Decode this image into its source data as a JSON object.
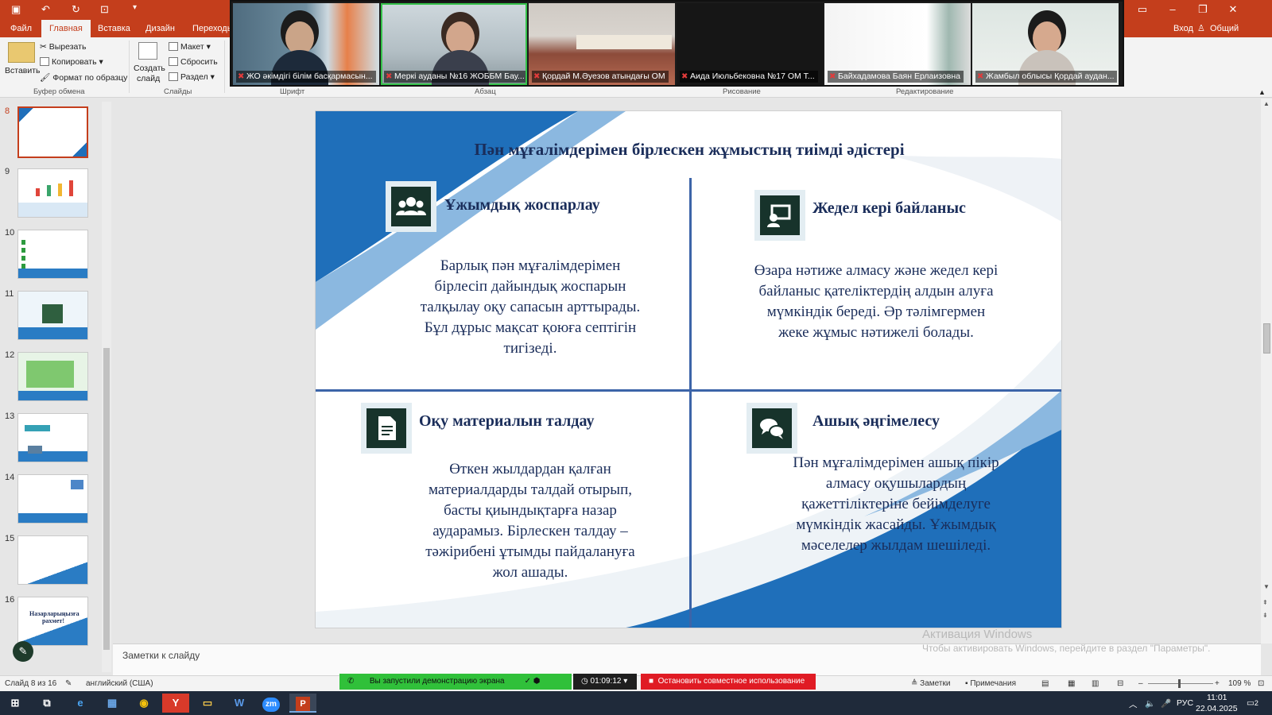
{
  "window": {
    "login_label": "Вход",
    "share_label": "Общий доступ"
  },
  "tabs": [
    {
      "label": "Файл"
    },
    {
      "label": "Главная"
    },
    {
      "label": "Вставка"
    },
    {
      "label": "Дизайн"
    },
    {
      "label": "Переходы"
    }
  ],
  "ribbon": {
    "paste": "Вставить",
    "cut": "Вырезать",
    "copy": "Копировать",
    "format_painter": "Формат по образцу",
    "new_slide": "Создать",
    "new_slide_2": "слайд",
    "layout": "Макет",
    "reset": "Сбросить",
    "section": "Раздел",
    "groups": {
      "clipboard": "Буфер обмена",
      "slides": "Слайды",
      "font": "Шрифт",
      "paragraph": "Абзац",
      "drawing": "Рисование",
      "editing": "Редактирование"
    }
  },
  "video": [
    {
      "name": "ЖО әкімдігі білім басқармасын..."
    },
    {
      "name": "Меркі ауданы  №16 ЖОББМ  Бау..."
    },
    {
      "name": "Қордай М.Әуезов атындағы ОМ"
    },
    {
      "name": "Аида Июльбековна №17 ОМ Т..."
    },
    {
      "name": "Байхадамова Баян Ерлаизовна"
    },
    {
      "name": "Жамбыл облысы Қордай аудан..."
    }
  ],
  "thumbnails": [
    {
      "num": "8"
    },
    {
      "num": "9"
    },
    {
      "num": "10"
    },
    {
      "num": "11"
    },
    {
      "num": "12"
    },
    {
      "num": "13"
    },
    {
      "num": "14"
    },
    {
      "num": "15"
    },
    {
      "num": "16",
      "text": "Назарларыңызға рахмет!"
    }
  ],
  "slide": {
    "title": "Пән мұғалімдерімен бірлескен жұмыстың тиімді әдістері",
    "q1": {
      "title": "Ұжымдық жоспарлау",
      "lines": [
        "Барлық пән мұғалімдерімен",
        "бірлесіп дайындық жоспарын",
        "талқылау оқу сапасын арттырады.",
        "Бұл дұрыс мақсат қоюға септігін",
        "тигізеді."
      ]
    },
    "q2": {
      "title": "Жедел кері байланыс",
      "lines": [
        "Өзара нәтиже алмасу және жедел кері",
        "байланыс қателіктердің алдын алуға",
        "мүмкіндік береді. Әр тәлімгермен",
        "жеке жұмыс нәтижелі болады."
      ]
    },
    "q3": {
      "title": "Оқу материалын талдау",
      "lines": [
        "Өткен жылдардан қалған",
        "материалдарды талдай отырып,",
        "басты қиындықтарға назар",
        "аударамыз. Бірлескен талдау –",
        "тәжірибені ұтымды пайдалануға",
        "жол ашады."
      ]
    },
    "q4": {
      "title": "Ашық әңгімелесу",
      "lines": [
        "Пән мұғалімдерімен ашық пікір",
        "алмасу оқушылардың",
        "қажеттіліктеріне бейімделуге",
        "мүмкіндік жасайды. Ұжымдық",
        "мәселелер жылдам шешіледі."
      ]
    }
  },
  "notes_placeholder": "Заметки к слайду",
  "activation": {
    "title": "Активация Windows",
    "subtitle": "Чтобы активировать Windows, перейдите в раздел \"Параметры\"."
  },
  "status": {
    "slide_info": "Слайд 8 из 16",
    "language": "английский (США)",
    "notes": "Заметки",
    "comments": "Примечания",
    "zoom": "109 %"
  },
  "share": {
    "message": "Вы запустили демонстрацию экрана",
    "timer": "01:09:12",
    "stop": "Остановить совместное использование"
  },
  "tray": {
    "lang": "РУС",
    "time": "11:01",
    "date": "22.04.2025",
    "notif_count": "2"
  },
  "colors": {
    "ppt_accent": "#c43e1c",
    "slide_title": "#1a2d5a",
    "slide_blue": "#1f6fba"
  }
}
